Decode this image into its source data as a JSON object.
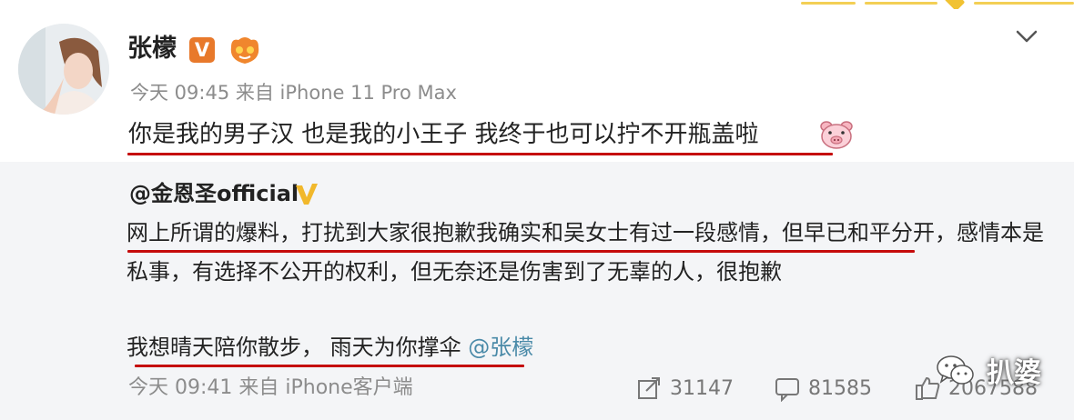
{
  "post": {
    "username": "张檬",
    "vip_badge": "V",
    "meta": "今天 09:45 来自 iPhone 11 Pro Max",
    "text": "你是我的男子汉  也是我的小王子  我终于也可以拧不开瓶盖啦",
    "emoji": "pig-face-icon",
    "more_icon": "chevron-down-icon"
  },
  "repost": {
    "author": "@金恩圣official",
    "line1": "网上所谓的爆料，打扰到大家很抱歉我确实和吴女士有过一段感情，但早已和平分开，感情本是",
    "line2": "私事，有选择不公开的权利，但无奈还是伤害到了无辜的人，很抱歉",
    "line3_text": "我想晴天陪你散步，  雨天为你撑伞 ",
    "line3_mention": "@张檬",
    "footer_meta": "今天 09:41 来自 iPhone客户端",
    "actions": {
      "repost_count": "31147",
      "comment_count": "81585",
      "like_count": "2067588"
    }
  },
  "watermark": {
    "text": "扒婆"
  },
  "colors": {
    "underline": "#c50b0b",
    "vip_orange": "#e8792b",
    "verify_gold": "#f1b82c",
    "mention_blue": "#4a8aa8",
    "repost_bg": "#f4f5f7"
  }
}
